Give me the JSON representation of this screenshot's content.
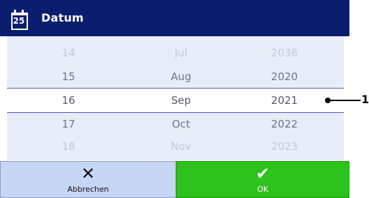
{
  "header": {
    "icon": "calendar-icon",
    "icon_day": "25",
    "title": "Datum"
  },
  "picker": {
    "rows": [
      {
        "day": "14",
        "month": "Jul",
        "year": "2036",
        "state": "faded"
      },
      {
        "day": "15",
        "month": "Aug",
        "year": "2020",
        "state": "normal"
      },
      {
        "day": "16",
        "month": "Sep",
        "year": "2021",
        "state": "selected"
      },
      {
        "day": "17",
        "month": "Oct",
        "year": "2022",
        "state": "normal"
      },
      {
        "day": "18",
        "month": "Nov",
        "year": "2023",
        "state": "faded"
      }
    ]
  },
  "footer": {
    "cancel_icon": "close-icon",
    "cancel_label": "Abbrechen",
    "ok_icon": "checkmark-icon",
    "ok_label": "OK"
  },
  "callout": {
    "label": "1"
  },
  "colors": {
    "titlebar": "#0b1d6e",
    "picker_bg": "#e8edf9",
    "cancel_bg": "#c8d6f5",
    "ok_bg": "#2dc21c"
  }
}
